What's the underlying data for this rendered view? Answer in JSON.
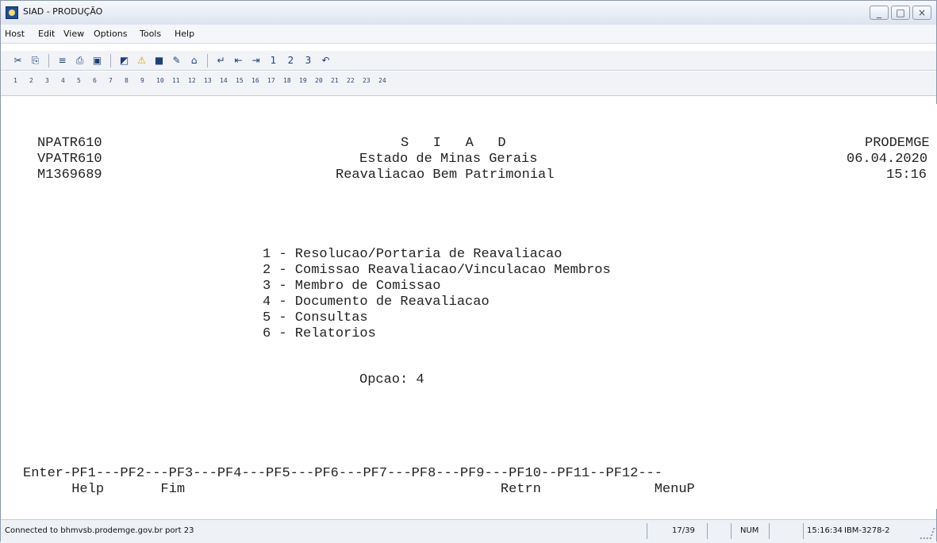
{
  "window": {
    "title": "SIAD - PRODUÇÃO"
  },
  "menu": [
    "Host",
    "Edit",
    "View",
    "Options",
    "Tools",
    "Help"
  ],
  "toolbar_icons": [
    "cut-icon",
    "copy-icon",
    "paste-icon",
    "playback-icon",
    "print-icon",
    "host-icon",
    "macro-icon",
    "alert-icon",
    "screen-icon",
    "pen-icon",
    "home-icon",
    "enter-icon",
    "tab-back-icon",
    "tab-forward-icon",
    "p1-icon",
    "p2-icon",
    "p3-icon",
    "undo-icon"
  ],
  "pf_keys": [
    "1",
    "2",
    "3",
    "4",
    "5",
    "6",
    "7",
    "8",
    "9",
    "10",
    "11",
    "12",
    "13",
    "14",
    "15",
    "16",
    "17",
    "18",
    "19",
    "20",
    "21",
    "22",
    "23",
    "24"
  ],
  "screen": {
    "header_left": [
      "NPATR610",
      "VPATR610",
      "M1369689"
    ],
    "header_center": [
      "S   I   A   D",
      "Estado de Minas Gerais",
      "Reavaliacao Bem Patrimonial"
    ],
    "header_right": [
      "PRODEMGE",
      "06.04.2020",
      "15:16"
    ],
    "menu_items": [
      "1 - Resolucao/Portaria de Reavaliacao",
      "2 - Comissao Reavaliacao/Vinculacao Membros",
      "3 - Membro de Comissao",
      "4 - Documento de Reavaliacao",
      "5 - Consultas",
      "6 - Relatorios"
    ],
    "option_prompt": "Opcao: 4",
    "pf_line": "Enter-PF1---PF2---PF3---PF4---PF5---PF6---PF7---PF8---PF9---PF10--PF11--PF12---",
    "pf_labels": "      Help       Fim                                       Retrn              MenuP"
  },
  "status": {
    "connection": "Connected to bhmvsb.prodemge.gov.br port 23",
    "cursor": "17/39",
    "mode": "NUM",
    "time": "15:16:34",
    "terminal": "IBM-3278-2"
  }
}
